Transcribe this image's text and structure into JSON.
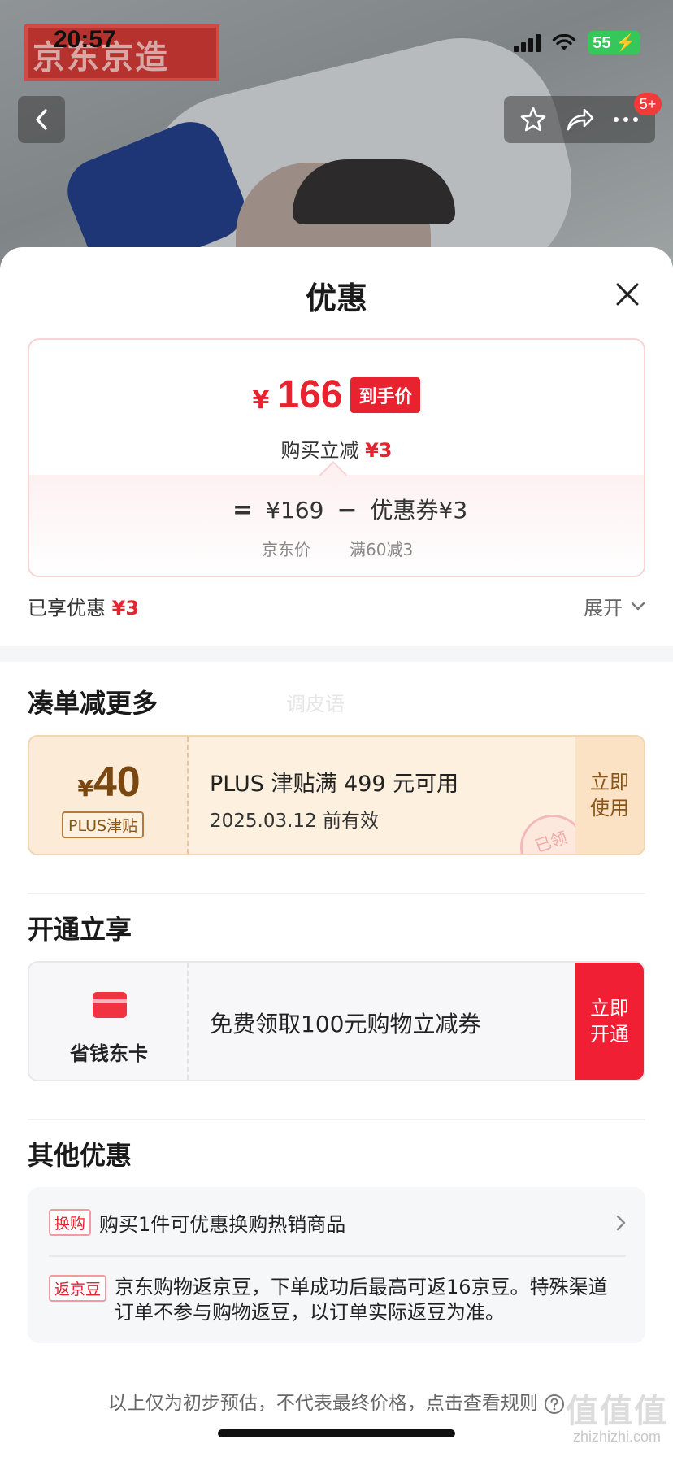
{
  "status_bar": {
    "time": "20:57",
    "battery": "55"
  },
  "hero": {
    "brand": "京东京造",
    "badge_count": "5+"
  },
  "sheet": {
    "title": "优惠",
    "price": {
      "currency": "¥",
      "final_price": "166",
      "final_tag": "到手价",
      "reduce_label": "购买立减",
      "reduce_amount": "¥3",
      "equals": "=",
      "jd_price": "¥169",
      "minus": "−",
      "coupon_part": "优惠券¥3",
      "jd_price_label": "京东价",
      "coupon_rule": "满60减3"
    },
    "enjoyed": {
      "label": "已享优惠",
      "amount": "¥3",
      "expand_label": "展开"
    },
    "bundle": {
      "section_title": "凑单减更多",
      "watermark": "调皮语",
      "coupon": {
        "currency": "¥",
        "amount": "40",
        "tag": "PLUS津贴",
        "desc": "PLUS 津贴满 499 元可用",
        "valid": "2025.03.12 前有效",
        "stamp": "已领",
        "button": "立即使用"
      }
    },
    "activate": {
      "section_title": "开通立享",
      "card_name": "省钱东卡",
      "desc": "免费领取100元购物立减券",
      "button": "立即开通"
    },
    "other": {
      "section_title": "其他优惠",
      "items": [
        {
          "tag": "换购",
          "text": "购买1件可优惠换购热销商品"
        },
        {
          "tag": "返京豆",
          "text": "京东购物返京豆，下单成功后最高可返16京豆。特殊渠道订单不参与购物返豆，以订单实际返豆为准。"
        }
      ]
    },
    "footer_note": "以上仅为初步预估，不代表最终价格，点击查看规则",
    "site_mark_big": "值值值",
    "site_mark_small": "zhizhizhi.com"
  },
  "colors": {
    "accent_red": "#e8222f",
    "plus_gold": "#7a4710",
    "activate_red": "#f01f33"
  }
}
